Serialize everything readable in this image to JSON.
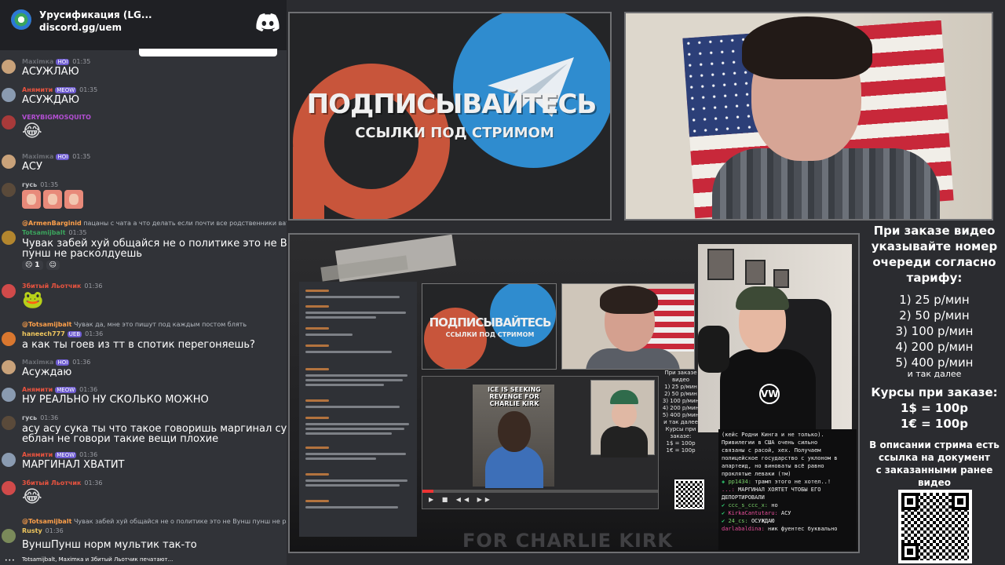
{
  "server": {
    "name": "Урусификация (LG...",
    "invite": "discord.gg/uem"
  },
  "messages": [
    {
      "user": "Maximкa",
      "user_color": "#6b6e74",
      "badge": "HOI",
      "time": "01:35",
      "text": "АСУЖЛАЮ",
      "avatar_color": "#c9a27a"
    },
    {
      "user": "Анямити",
      "user_color": "#e8533f",
      "badge": "MEOW",
      "time": "01:35",
      "text": "АСУЖДАЮ",
      "avatar_color": "#8a9bb1"
    },
    {
      "user": "VERYBIGMOSQUITO",
      "user_color": "#b34fd3",
      "badge": "",
      "time": "",
      "emoji": "😂",
      "avatar_color": "#a83a3a"
    },
    {
      "user": "Maximкa",
      "user_color": "#6b6e74",
      "badge": "HOI",
      "time": "01:35",
      "text": "АСУ",
      "avatar_color": "#c9a27a"
    },
    {
      "user": "гусь",
      "user_color": "#c2c4c8",
      "badge": "",
      "time": "01:35",
      "stickers": true,
      "avatar_color": "#5a4a3a"
    },
    {
      "reply_user": "@ArmenBarginid",
      "reply_text": "пацаны с чата а что делать если почти все родственники ватные что пиздец?",
      "user": "Totsamijbalt",
      "user_color": "#3ba55d",
      "badge": "",
      "time": "01:35",
      "text": "Чувак забей хуй общайся не о политике это не Вунш",
      "text2": "пунш не расколдуешь",
      "reactions": [
        "1"
      ],
      "avatar_color": "#b3862e"
    },
    {
      "user": "3битый Льотчик",
      "user_color": "#e8533f",
      "badge": "",
      "time": "01:36",
      "emoji": "🐸",
      "avatar_color": "#d04a4a"
    },
    {
      "reply_user": "@Totsamijbalt",
      "reply_text": "Чувак да, мне это пишут под каждым постом блять",
      "user": "haneech777",
      "user_color": "#f0c75e",
      "badge": "UEB",
      "time": "01:36",
      "text": "а как ты гоев из тт в спотик перегоняешь?",
      "avatar_color": "#d9772f"
    },
    {
      "user": "Maximкa",
      "user_color": "#6b6e74",
      "badge": "HOI",
      "time": "01:36",
      "text": "Асуждаю",
      "avatar_color": "#c9a27a"
    },
    {
      "user": "Анямити",
      "user_color": "#e8533f",
      "badge": "MEOW",
      "time": "01:36",
      "text": "НУ РЕАЛЬНО НУ СКОЛЬКО МОЖНО",
      "avatar_color": "#8a9bb1"
    },
    {
      "user": "гусь",
      "user_color": "#c2c4c8",
      "badge": "",
      "time": "01:36",
      "text": "асу асу сука ты что такое говоришь маргинал сука",
      "text2": "еблан не говори такие вещи плохие",
      "avatar_color": "#5a4a3a"
    },
    {
      "user": "Анямити",
      "user_color": "#e8533f",
      "badge": "MEOW",
      "time": "01:36",
      "text": "МАРГИНАЛ ХВАТИТ",
      "avatar_color": "#8a9bb1"
    },
    {
      "user": "3битый Льотчик",
      "user_color": "#e8533f",
      "badge": "",
      "time": "01:36",
      "emoji": "😂",
      "avatar_color": "#d04a4a"
    },
    {
      "reply_user": "@Totsamijbalt",
      "reply_text": "Чувак забей хуй общайся не о политике это не Вунш пунш не расколдуешь",
      "user": "Rusty",
      "user_color": "#f0c75e",
      "badge": "",
      "time": "01:36",
      "text": "ВуншПунш норм мультик так-то",
      "avatar_color": "#7a8a5a"
    }
  ],
  "typing": "Totsamijbalt, Maximкa и 3битый Льотчик печатают...",
  "banner": {
    "title": "ПОДПИСЫВАЙТЕСЬ",
    "subtitle": "ССЫЛКИ ПОД СТРИМОМ"
  },
  "capture": {
    "overlay_text": "FOR CHARLIE KIRK",
    "video_caption": "ICE IS SEEKING REVENGE FOR CHARLIE KIRK",
    "mini_banner_title": "ПОДПИСЫВАЙТЕСЬ",
    "mini_banner_sub": "ССЫЛКИ ПОД СТРИМОМ",
    "vw": "VW",
    "term_lines": [
      {
        "user": "",
        "text": "(кейс Родни Кинга и не только)."
      },
      {
        "user": "",
        "text": "Привилегии в США очень сильно"
      },
      {
        "user": "",
        "text": "связаны с расой, хех. Получаем"
      },
      {
        "user": "",
        "text": "полицейское государство с уклоном в"
      },
      {
        "user": "",
        "text": "апартеид, но виноваты всё равно"
      },
      {
        "user": "",
        "text": "проклятые леваки (тм)"
      },
      {
        "user": "pp1434:",
        "text": "трамп этого не хотел..!"
      },
      {
        "user": "...:",
        "text": "МАРГИНАЛ ХОЯТЕТ ЧТОБЫ ЕГО"
      },
      {
        "user": "",
        "text": "ДЕПОРТИРОВАЛИ"
      },
      {
        "user": "ccc_s_ccc_x:",
        "text": "но"
      },
      {
        "user": "KirkaCantutaru:",
        "text": "АСУ"
      },
      {
        "user": "24_cs:",
        "text": "ОСУЖДАЮ"
      },
      {
        "user": "darlabaldina:",
        "text": "ник фуентес буквально"
      }
    ]
  },
  "info": {
    "order_text": [
      "При заказе видео",
      "указывайте номер",
      "очереди согласно",
      "тарифу:"
    ],
    "tariffs": [
      "1) 25 р/мин",
      "2) 50 р/мин",
      "3) 100 р/мин",
      "4) 200 р/мин",
      "5) 400 р/мин"
    ],
    "etc": "и так далее",
    "rates_title": "Курсы при заказе:",
    "rates": [
      "1$ = 100р",
      "1€ = 100р"
    ],
    "desc": [
      "В описании стрима есть",
      "ссылка на документ",
      "с заказанными ранее",
      "видео"
    ]
  },
  "colors": {
    "patreon": "#c8553b",
    "telegram": "#2f8ccf",
    "chat_bg": "#313338"
  }
}
